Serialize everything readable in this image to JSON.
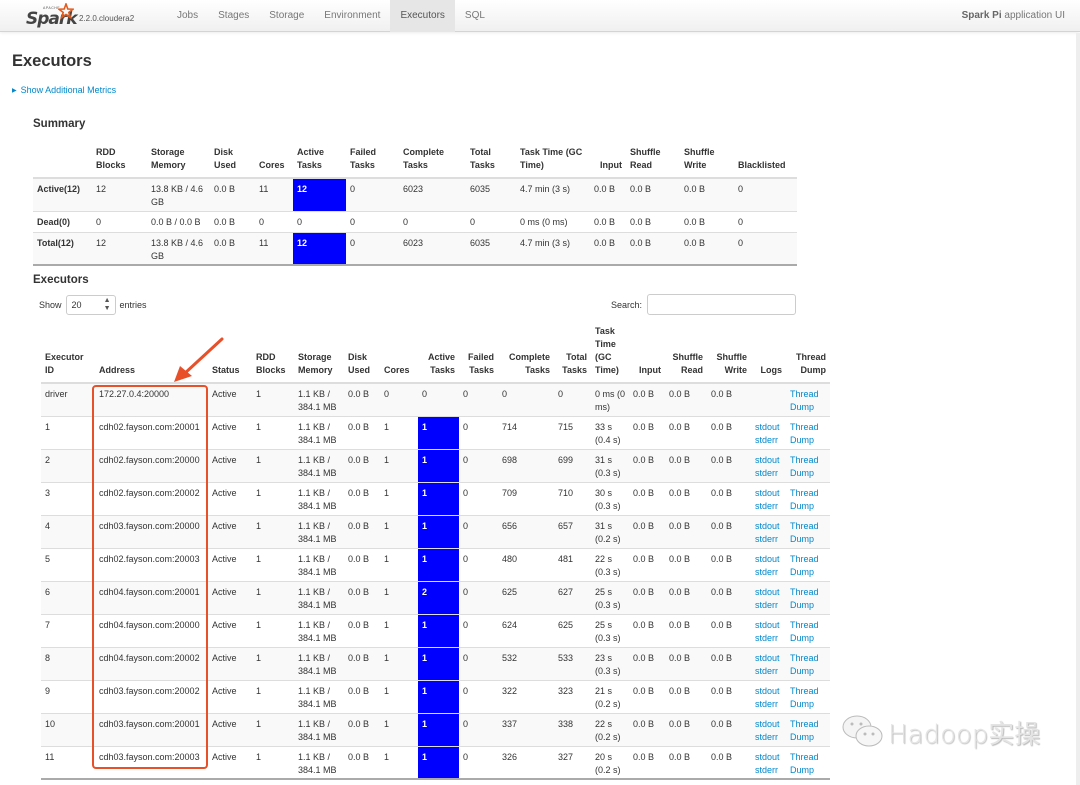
{
  "navbar": {
    "brand_apache": "APACHE",
    "brand_word": "Spark",
    "version": "2.2.0.cloudera2",
    "tabs": [
      {
        "label": "Jobs",
        "active": false
      },
      {
        "label": "Stages",
        "active": false
      },
      {
        "label": "Storage",
        "active": false
      },
      {
        "label": "Environment",
        "active": false
      },
      {
        "label": "Executors",
        "active": true
      },
      {
        "label": "SQL",
        "active": false
      }
    ],
    "app_name": "Spark Pi",
    "app_suffix": " application UI"
  },
  "page": {
    "title": "Executors",
    "additional_metrics_label": "Show Additional Metrics"
  },
  "summary": {
    "title": "Summary",
    "headers": [
      "",
      "RDD Blocks",
      "Storage Memory",
      "Disk Used",
      "Cores",
      "Active Tasks",
      "Failed Tasks",
      "Complete Tasks",
      "Total Tasks",
      "Task Time (GC Time)",
      "Input",
      "Shuffle Read",
      "Shuffle Write",
      "Blacklisted"
    ],
    "rows": [
      {
        "label": "Active(12)",
        "rdd": "12",
        "storage": "13.8 KB / 4.6 GB",
        "disk": "0.0 B",
        "cores": "11",
        "active": "12",
        "failed": "0",
        "complete": "6023",
        "total": "6035",
        "time": "4.7 min (3 s)",
        "input": "0.0 B",
        "sread": "0.0 B",
        "swrite": "0.0 B",
        "blacklisted": "0"
      },
      {
        "label": "Dead(0)",
        "rdd": "0",
        "storage": "0.0 B / 0.0 B",
        "disk": "0.0 B",
        "cores": "0",
        "active": "0",
        "failed": "0",
        "complete": "0",
        "total": "0",
        "time": "0 ms (0 ms)",
        "input": "0.0 B",
        "sread": "0.0 B",
        "swrite": "0.0 B",
        "blacklisted": "0"
      },
      {
        "label": "Total(12)",
        "rdd": "12",
        "storage": "13.8 KB / 4.6 GB",
        "disk": "0.0 B",
        "cores": "11",
        "active": "12",
        "failed": "0",
        "complete": "6023",
        "total": "6035",
        "time": "4.7 min (3 s)",
        "input": "0.0 B",
        "sread": "0.0 B",
        "swrite": "0.0 B",
        "blacklisted": "0"
      }
    ]
  },
  "executors": {
    "title": "Executors",
    "show_label": "Show",
    "page_size": "20",
    "entries_label": "entries",
    "search_label": "Search:",
    "search_value": "",
    "headers": [
      "Executor ID",
      "Address",
      "Status",
      "RDD Blocks",
      "Storage Memory",
      "Disk Used",
      "Cores",
      "Active Tasks",
      "Failed Tasks",
      "Complete Tasks",
      "Total Tasks",
      "Task Time (GC Time)",
      "Input",
      "Shuffle Read",
      "Shuffle Write",
      "Logs",
      "Thread Dump"
    ],
    "rows": [
      {
        "id": "driver",
        "address": "172.27.0.4:20000",
        "status": "Active",
        "rdd": "1",
        "storage": "1.1 KB / 384.1 MB",
        "disk": "0.0 B",
        "cores": "0",
        "active": "0",
        "failed": "0",
        "complete": "0",
        "total": "0",
        "time": "0 ms (0 ms)",
        "input": "0.0 B",
        "sread": "0.0 B",
        "swrite": "0.0 B",
        "stdout": "",
        "stderr": "",
        "thread_dump": "Thread Dump",
        "highlight_active": false
      },
      {
        "id": "1",
        "address": "cdh02.fayson.com:20001",
        "status": "Active",
        "rdd": "1",
        "storage": "1.1 KB / 384.1 MB",
        "disk": "0.0 B",
        "cores": "1",
        "active": "1",
        "failed": "0",
        "complete": "714",
        "total": "715",
        "time": "33 s (0.4 s)",
        "input": "0.0 B",
        "sread": "0.0 B",
        "swrite": "0.0 B",
        "stdout": "stdout",
        "stderr": "stderr",
        "thread_dump": "Thread Dump",
        "highlight_active": true
      },
      {
        "id": "2",
        "address": "cdh02.fayson.com:20000",
        "status": "Active",
        "rdd": "1",
        "storage": "1.1 KB / 384.1 MB",
        "disk": "0.0 B",
        "cores": "1",
        "active": "1",
        "failed": "0",
        "complete": "698",
        "total": "699",
        "time": "31 s (0.3 s)",
        "input": "0.0 B",
        "sread": "0.0 B",
        "swrite": "0.0 B",
        "stdout": "stdout",
        "stderr": "stderr",
        "thread_dump": "Thread Dump",
        "highlight_active": true
      },
      {
        "id": "3",
        "address": "cdh02.fayson.com:20002",
        "status": "Active",
        "rdd": "1",
        "storage": "1.1 KB / 384.1 MB",
        "disk": "0.0 B",
        "cores": "1",
        "active": "1",
        "failed": "0",
        "complete": "709",
        "total": "710",
        "time": "30 s (0.3 s)",
        "input": "0.0 B",
        "sread": "0.0 B",
        "swrite": "0.0 B",
        "stdout": "stdout",
        "stderr": "stderr",
        "thread_dump": "Thread Dump",
        "highlight_active": true
      },
      {
        "id": "4",
        "address": "cdh03.fayson.com:20000",
        "status": "Active",
        "rdd": "1",
        "storage": "1.1 KB / 384.1 MB",
        "disk": "0.0 B",
        "cores": "1",
        "active": "1",
        "failed": "0",
        "complete": "656",
        "total": "657",
        "time": "31 s (0.2 s)",
        "input": "0.0 B",
        "sread": "0.0 B",
        "swrite": "0.0 B",
        "stdout": "stdout",
        "stderr": "stderr",
        "thread_dump": "Thread Dump",
        "highlight_active": true
      },
      {
        "id": "5",
        "address": "cdh02.fayson.com:20003",
        "status": "Active",
        "rdd": "1",
        "storage": "1.1 KB / 384.1 MB",
        "disk": "0.0 B",
        "cores": "1",
        "active": "1",
        "failed": "0",
        "complete": "480",
        "total": "481",
        "time": "22 s (0.3 s)",
        "input": "0.0 B",
        "sread": "0.0 B",
        "swrite": "0.0 B",
        "stdout": "stdout",
        "stderr": "stderr",
        "thread_dump": "Thread Dump",
        "highlight_active": true
      },
      {
        "id": "6",
        "address": "cdh04.fayson.com:20001",
        "status": "Active",
        "rdd": "1",
        "storage": "1.1 KB / 384.1 MB",
        "disk": "0.0 B",
        "cores": "1",
        "active": "2",
        "failed": "0",
        "complete": "625",
        "total": "627",
        "time": "25 s (0.3 s)",
        "input": "0.0 B",
        "sread": "0.0 B",
        "swrite": "0.0 B",
        "stdout": "stdout",
        "stderr": "stderr",
        "thread_dump": "Thread Dump",
        "highlight_active": true
      },
      {
        "id": "7",
        "address": "cdh04.fayson.com:20000",
        "status": "Active",
        "rdd": "1",
        "storage": "1.1 KB / 384.1 MB",
        "disk": "0.0 B",
        "cores": "1",
        "active": "1",
        "failed": "0",
        "complete": "624",
        "total": "625",
        "time": "25 s (0.3 s)",
        "input": "0.0 B",
        "sread": "0.0 B",
        "swrite": "0.0 B",
        "stdout": "stdout",
        "stderr": "stderr",
        "thread_dump": "Thread Dump",
        "highlight_active": true
      },
      {
        "id": "8",
        "address": "cdh04.fayson.com:20002",
        "status": "Active",
        "rdd": "1",
        "storage": "1.1 KB / 384.1 MB",
        "disk": "0.0 B",
        "cores": "1",
        "active": "1",
        "failed": "0",
        "complete": "532",
        "total": "533",
        "time": "23 s (0.3 s)",
        "input": "0.0 B",
        "sread": "0.0 B",
        "swrite": "0.0 B",
        "stdout": "stdout",
        "stderr": "stderr",
        "thread_dump": "Thread Dump",
        "highlight_active": true
      },
      {
        "id": "9",
        "address": "cdh03.fayson.com:20002",
        "status": "Active",
        "rdd": "1",
        "storage": "1.1 KB / 384.1 MB",
        "disk": "0.0 B",
        "cores": "1",
        "active": "1",
        "failed": "0",
        "complete": "322",
        "total": "323",
        "time": "21 s (0.2 s)",
        "input": "0.0 B",
        "sread": "0.0 B",
        "swrite": "0.0 B",
        "stdout": "stdout",
        "stderr": "stderr",
        "thread_dump": "Thread Dump",
        "highlight_active": true
      },
      {
        "id": "10",
        "address": "cdh03.fayson.com:20001",
        "status": "Active",
        "rdd": "1",
        "storage": "1.1 KB / 384.1 MB",
        "disk": "0.0 B",
        "cores": "1",
        "active": "1",
        "failed": "0",
        "complete": "337",
        "total": "338",
        "time": "22 s (0.2 s)",
        "input": "0.0 B",
        "sread": "0.0 B",
        "swrite": "0.0 B",
        "stdout": "stdout",
        "stderr": "stderr",
        "thread_dump": "Thread Dump",
        "highlight_active": true
      },
      {
        "id": "11",
        "address": "cdh03.fayson.com:20003",
        "status": "Active",
        "rdd": "1",
        "storage": "1.1 KB / 384.1 MB",
        "disk": "0.0 B",
        "cores": "1",
        "active": "1",
        "failed": "0",
        "complete": "326",
        "total": "327",
        "time": "20 s (0.2 s)",
        "input": "0.0 B",
        "sread": "0.0 B",
        "swrite": "0.0 B",
        "stdout": "stdout",
        "stderr": "stderr",
        "thread_dump": "Thread Dump",
        "highlight_active": true
      }
    ]
  },
  "annotation": {
    "highlight_color": "#e8502a"
  },
  "colors": {
    "active_task_highlight": "#0000ff",
    "link": "#0088cc"
  },
  "watermark": {
    "text": "Hadoop实操",
    "icon": "wechat-icon"
  }
}
